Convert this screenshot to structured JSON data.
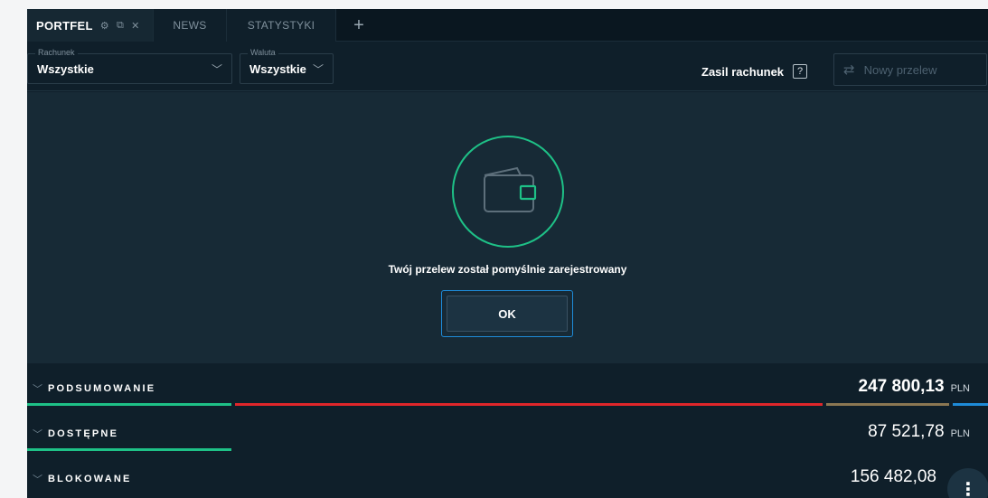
{
  "tabs": [
    {
      "label": "PORTFEL",
      "active": true
    },
    {
      "label": "NEWS",
      "active": false
    },
    {
      "label": "STATYSTYKI",
      "active": false
    }
  ],
  "tab_icons": {
    "settings": "gear-icon",
    "external": "external-link-icon",
    "close": "close-icon"
  },
  "add_tab_label": "+",
  "filters": {
    "account_label": "Rachunek",
    "account_value": "Wszystkie",
    "currency_label": "Waluta",
    "currency_value": "Wszystkie"
  },
  "zasil_label": "Zasil rachunek",
  "help_label": "?",
  "new_transfer_label": "Nowy przelew",
  "modal": {
    "message": "Twój przelew został pomyślnie zarejestrowany",
    "ok_label": "OK"
  },
  "summary": [
    {
      "label": "PODSUMOWANIE",
      "amount": "247 800,13",
      "currency": "PLN"
    },
    {
      "label": "DOSTĘPNE",
      "amount": "87 521,78",
      "currency": "PLN"
    },
    {
      "label": "BLOKOWANE",
      "amount": "156 482,08",
      "currency": ""
    }
  ],
  "colors": {
    "accent_green": "#1ec187",
    "bar_red": "#e0262a",
    "bar_brown": "#8b7752",
    "bar_blue": "#1e8bd8",
    "focus_blue": "#1e8bd8"
  }
}
